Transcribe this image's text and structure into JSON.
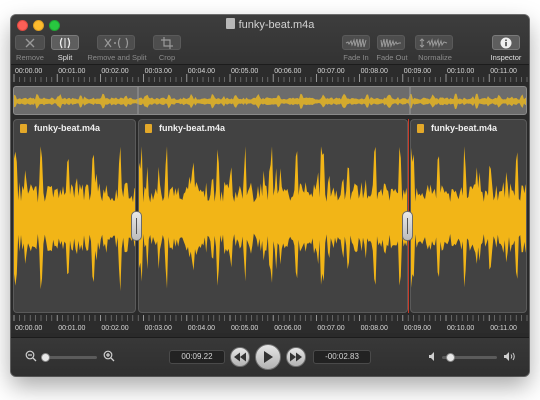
{
  "window": {
    "title": "funky-beat.m4a"
  },
  "toolbar": {
    "remove_label": "Remove",
    "split_label": "Split",
    "remove_and_split_label": "Remove and Split",
    "crop_label": "Crop",
    "fade_in_label": "Fade In",
    "fade_out_label": "Fade Out",
    "normalize_label": "Normalize",
    "inspector_label": "Inspector"
  },
  "ruler": {
    "ticks": [
      "00:00.00",
      "00:01.00",
      "00:02.00",
      "00:03.00",
      "00:04.00",
      "00:05.00",
      "00:06.00",
      "00:07.00",
      "00:08.00",
      "00:09.00",
      "00:10.00",
      "00:11.00"
    ]
  },
  "clips": [
    {
      "title": "funky-beat.m4a"
    },
    {
      "title": "funky-beat.m4a"
    },
    {
      "title": "funky-beat.m4a"
    }
  ],
  "transport": {
    "current_time": "00:09.22",
    "remaining_time": "-00:02.83"
  },
  "zoom_level": 0.0,
  "volume_level": 0.1,
  "colors": {
    "waveform": "#f2b517",
    "playhead": "#c93a28",
    "overview_wave": "#e0b128"
  }
}
